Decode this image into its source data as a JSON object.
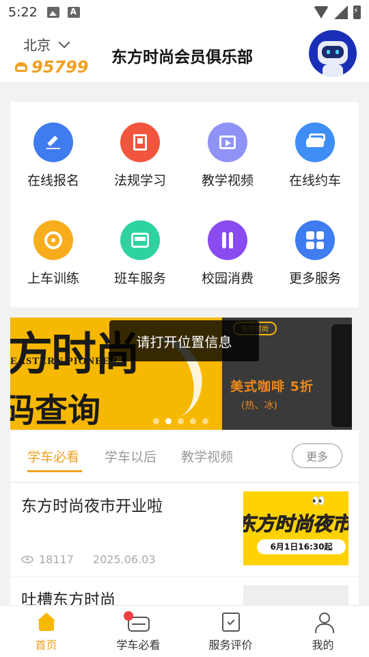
{
  "status_bar": {
    "time": "5:22"
  },
  "header": {
    "city": "北京",
    "phone": "95799",
    "title": "东方时尚会员俱乐部"
  },
  "services": [
    {
      "label": "在线报名",
      "icon": "pen-icon",
      "color": "#3f7cf0"
    },
    {
      "label": "法规学习",
      "icon": "book-icon",
      "color": "#f2553d"
    },
    {
      "label": "教学视频",
      "icon": "film-icon",
      "color": "#8f93f5"
    },
    {
      "label": "在线约车",
      "icon": "car-icon",
      "color": "#3f8ef5"
    },
    {
      "label": "上车训练",
      "icon": "steering-wheel-icon",
      "color": "#f8ad1c"
    },
    {
      "label": "班车服务",
      "icon": "bus-icon",
      "color": "#2ed1a0"
    },
    {
      "label": "校园消费",
      "icon": "fork-knife-icon",
      "color": "#8a4bf0"
    },
    {
      "label": "更多服务",
      "icon": "grid-icon",
      "color": "#3f7cf0"
    }
  ],
  "banner": {
    "left_big": "方时尚",
    "left_en": "EASTERN PIONEER",
    "left_query": "码查询",
    "right_logo": "东方时尚",
    "right_promo": "美式咖啡  5折",
    "right_sub": "(热、冰)",
    "slide_count": 5,
    "active_slide": 2
  },
  "toast": "请打开位置信息",
  "tabs": {
    "items": [
      "学车必看",
      "学车以后",
      "教学视频"
    ],
    "active": 0,
    "more": "更多"
  },
  "news": [
    {
      "title": "东方时尚夜市开业啦",
      "views": "18117",
      "date": "2025.06.03",
      "thumb_text": "东方时尚夜市",
      "thumb_pill": "6月1日16:30起"
    },
    {
      "title": "吐槽东方时尚"
    }
  ],
  "bottom_nav": [
    {
      "label": "首页",
      "icon": "home-icon",
      "active": true
    },
    {
      "label": "学车必看",
      "icon": "car-icon",
      "active": false
    },
    {
      "label": "服务评价",
      "icon": "clipboard-check-icon",
      "active": false
    },
    {
      "label": "我的",
      "icon": "user-icon",
      "active": false
    }
  ],
  "colors": {
    "accent": "#f0a020",
    "brand_blue": "#1a2fb8"
  }
}
